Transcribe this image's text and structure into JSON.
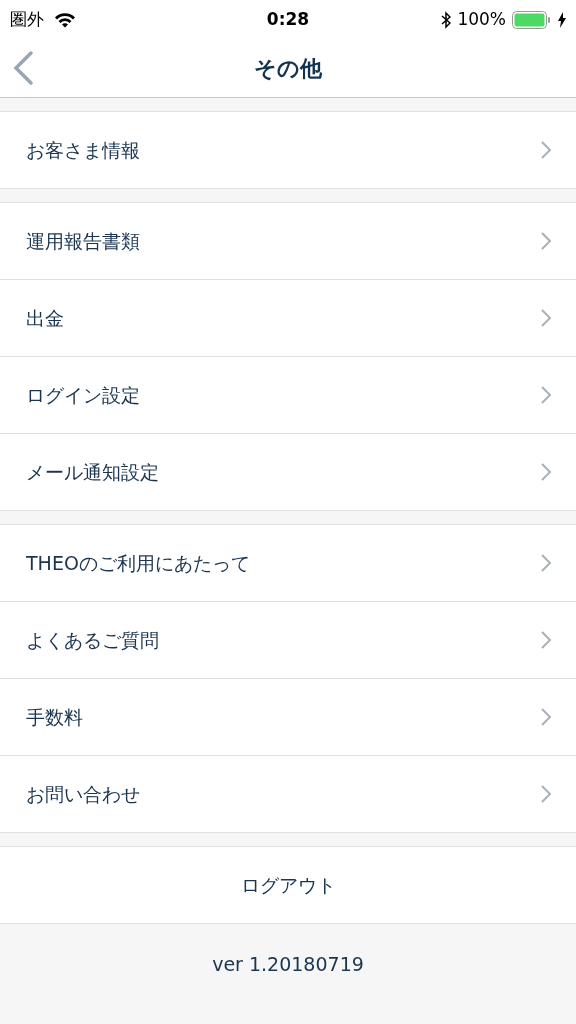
{
  "status_bar": {
    "carrier": "圏外",
    "time": "0:28",
    "battery": "100%"
  },
  "nav": {
    "title": "その他"
  },
  "groups": [
    {
      "items": [
        "お客さま情報"
      ]
    },
    {
      "items": [
        "運用報告書類",
        "出金",
        "ログイン設定",
        "メール通知設定"
      ]
    },
    {
      "items": [
        "THEOのご利用にあたって",
        "よくあるご質問",
        "手数料",
        "お問い合わせ"
      ]
    }
  ],
  "logout": "ログアウト",
  "version": "ver 1.20180719"
}
